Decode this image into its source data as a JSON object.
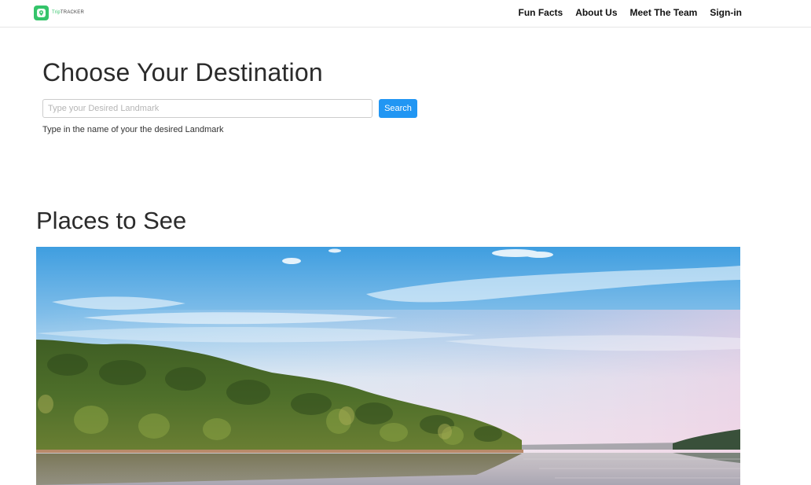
{
  "brand": {
    "name_trip": "Trip",
    "name_tracker": "TRACKER",
    "logo_color": "#34c46a"
  },
  "nav": {
    "items": [
      {
        "label": "Fun Facts"
      },
      {
        "label": "About Us"
      },
      {
        "label": "Meet The Team"
      },
      {
        "label": "Sign-in"
      }
    ]
  },
  "hero": {
    "title": "Choose Your Destination",
    "search": {
      "placeholder": "Type your Desired Landmark",
      "value": "",
      "button_label": "Search",
      "button_color": "#2196f3"
    },
    "help_text": "Type in the name of your the desired Landmark"
  },
  "places": {
    "title": "Places to See",
    "image_icon": "lake-landscape-photo"
  }
}
